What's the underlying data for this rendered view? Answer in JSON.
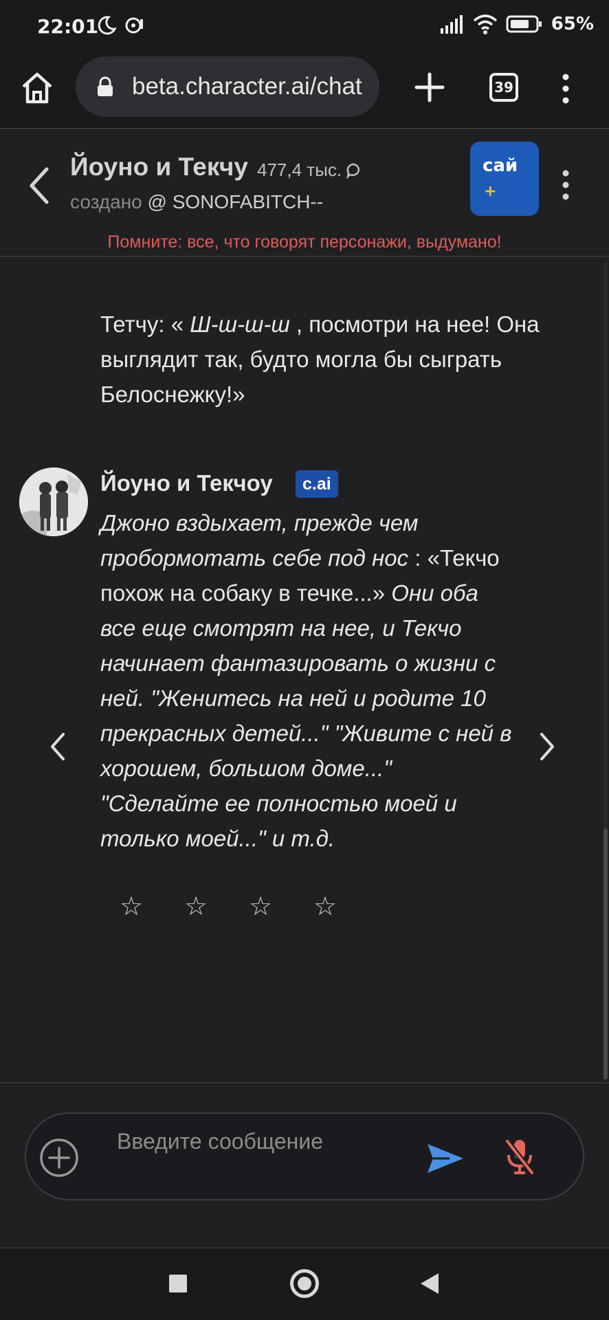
{
  "status_bar": {
    "time": "22:01",
    "left_icons": [
      "moon-icon",
      "media-icon"
    ],
    "right_icons": [
      "signal-icon",
      "wifi-icon",
      "battery-icon"
    ],
    "battery": "65%"
  },
  "browser": {
    "url": "beta.character.ai/chat",
    "tab_count": "39",
    "icons": [
      "home-icon",
      "lock-icon",
      "plus-icon",
      "tabs-icon",
      "more-vert-icon"
    ]
  },
  "chat_header": {
    "character_name": "Йоуно и Текчу",
    "chat_count": "477,4 тыс.",
    "creator_prefix": "создано",
    "creator_handle": "@ SONOFABITCH--",
    "plus_badge": "сай",
    "plus_badge_symbol": "+",
    "disclaimer": "Помните: все, что говорят персонажи, выдумано!"
  },
  "messages": {
    "previous": {
      "p1": "Тетчу: « ",
      "p2": "Ш-ш-ш-ш",
      "p3": " , посмотри на нее! Она выглядит так, будто могла бы сыграть Белоснежку!»"
    },
    "bot": {
      "name": "Йоуно и Текчоу",
      "tag": "c.ai",
      "s1": "Джоно вздыхает, прежде чем пробормотать себе под нос",
      "s2": " : «Текчо похож на собаку в течке...»",
      "s3": " Они оба все еще смотрят на нее, и Текчо начинает фантазировать о жизни с ней. \"Женитесь на ней и родите 10 прекрасных детей...\" \"Живите с ней в хорошем, большом доме...\" \"Сделайте ее полностью моей и только моей...\" и т.д."
    },
    "rating": [
      "☆",
      "☆",
      "☆",
      "☆"
    ]
  },
  "input": {
    "placeholder": "Введите сообщение"
  },
  "colors": {
    "background": "#202023",
    "accent_blue": "#1e5bb8",
    "disclaimer_red": "#e05a55",
    "send_blue": "#4a8fe3",
    "mic_red": "#e0685f"
  }
}
